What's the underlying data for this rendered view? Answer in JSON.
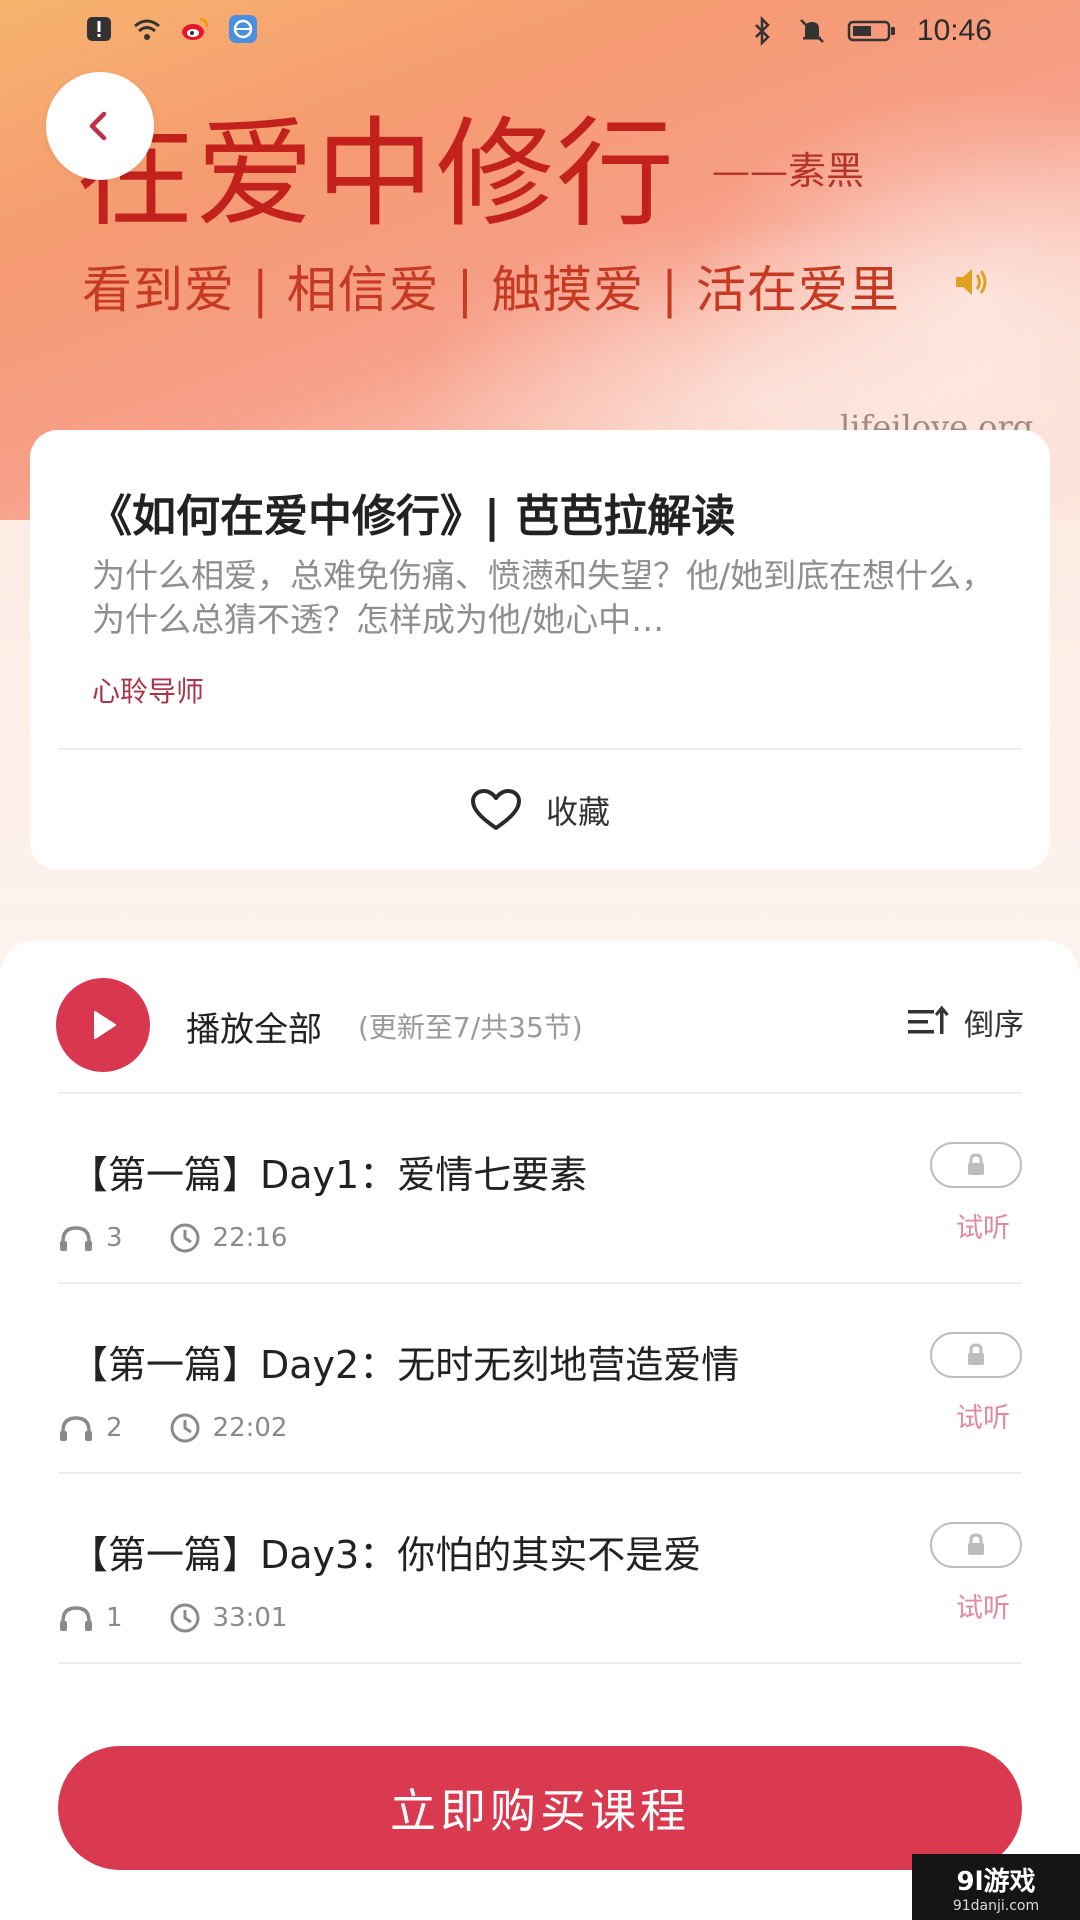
{
  "status_bar": {
    "time": "10:46"
  },
  "hero": {
    "title": "在爱中修行",
    "author": "——素黑",
    "tagline": "看到爱 | 相信爱 | 触摸爱 | 活在爱里",
    "site": "lifeilove.org"
  },
  "course": {
    "title": "《如何在爱中修行》| 芭芭拉解读",
    "description": "为什么相爱，总难免伤痛、愤懑和失望？他/她到底在想什么，为什么总猜不透？怎样成为他/她心中…",
    "teacher": "心聆导师",
    "favorite_label": "收藏"
  },
  "playlist": {
    "play_all_label": "播放全部",
    "play_all_sub": "(更新至7/共35节)",
    "sort_label": "倒序",
    "episodes": [
      {
        "title": "【第一篇】Day1：爱情七要素",
        "listens": "3",
        "duration": "22:16",
        "trial": "试听"
      },
      {
        "title": "【第一篇】Day2：无时无刻地营造爱情",
        "listens": "2",
        "duration": "22:02",
        "trial": "试听"
      },
      {
        "title": "【第一篇】Day3：你怕的其实不是爱",
        "listens": "1",
        "duration": "33:01",
        "trial": "试听"
      }
    ]
  },
  "buy_button": {
    "label": "立即购买课程"
  },
  "watermark": {
    "main": "9l游戏",
    "sub": "91danji.com"
  },
  "colors": {
    "accent": "#d93a4f",
    "teacher": "#a8364b",
    "trial": "#e28aa0"
  }
}
